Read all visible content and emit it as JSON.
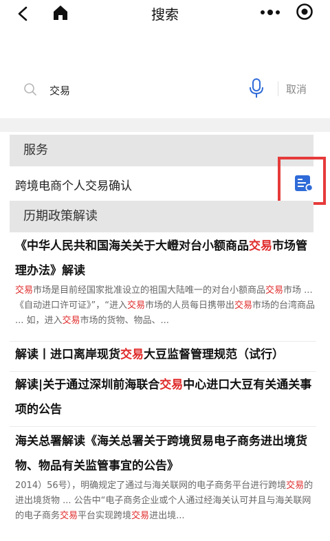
{
  "header": {
    "title": "搜索"
  },
  "search": {
    "value": "交易",
    "cancel_label": "取消"
  },
  "sections": {
    "service_label": "服务",
    "policy_label": "历期政策解读"
  },
  "service": {
    "item_label": "跨境电商个人交易确认"
  },
  "highlight_keyword": "交易",
  "colors": {
    "highlight": "#e02a2a",
    "accent_blue": "#2f6bd8",
    "annotation_box": "#e63a3a"
  },
  "articles": [
    {
      "title": "《中华人民共和国海关关于大嶝对台小额商品交易市场管理办法》解读",
      "excerpt": "交易市场是目前经国家批准设立的祖国大陆唯一的对台小额商品交易市场 ... 《自动进口许可证》”，“进入交易市场的人员每日携带出交易市场的台湾商品 ... 如，进入交易市场的货物、物品、..."
    },
    {
      "title": "解读丨进口离岸现货交易大豆监督管理规范（试行）",
      "excerpt": ""
    },
    {
      "title": "解读|关于通过深圳前海联合交易中心进口大豆有关通关事项的公告",
      "excerpt": ""
    },
    {
      "title": "海关总署解读《海关总署关于跨境贸易电子商务进出境货物、物品有关监管事宜的公告》",
      "excerpt": "2014）56号），明确规定了通过与海关联网的电子商务平台进行跨境交易的进出境货物 ... 公告中“电子商务企业或个人通过经海关认可并且与海关联网的电子商务交易平台实现跨境交易进出境..."
    }
  ]
}
